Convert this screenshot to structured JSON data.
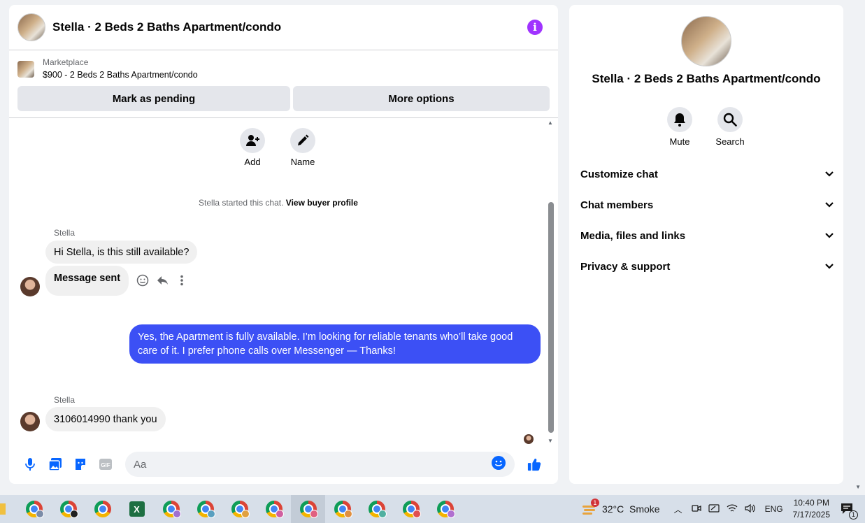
{
  "chat": {
    "title": "Stella · 2 Beds 2 Baths Apartment/condo",
    "marketplace_label": "Marketplace",
    "listing": "$900 - 2 Beds 2 Baths Apartment/condo",
    "mark_pending": "Mark as pending",
    "more_options": "More options",
    "quick_actions": [
      {
        "label": "Add",
        "icon": "add-person-icon"
      },
      {
        "label": "Name",
        "icon": "pencil-icon"
      }
    ],
    "started_text": "Stella started this chat.",
    "view_profile": "View buyer profile",
    "messages": [
      {
        "sender": "Stella",
        "text": "Hi Stella, is this still available?",
        "direction": "in"
      },
      {
        "text": "Message sent",
        "direction": "in"
      },
      {
        "text": "Yes, the Apartment is fully available. I’m looking for reliable tenants who’ll take good care of it. I prefer phone calls over Messenger —  Thanks!",
        "direction": "out"
      },
      {
        "sender": "Stella",
        "text": "3106014990 thank you",
        "direction": "in"
      }
    ],
    "composer_placeholder": "Aa",
    "accent": "#0866ff",
    "outgoing_bubble": "#3c50f5"
  },
  "side": {
    "title": "Stella · 2 Beds 2 Baths Apartment/condo",
    "actions": [
      {
        "label": "Mute",
        "icon": "bell-icon"
      },
      {
        "label": "Search",
        "icon": "search-icon"
      }
    ],
    "sections": [
      "Customize chat",
      "Chat members",
      "Media, files and links",
      "Privacy & support"
    ]
  },
  "taskbar": {
    "weather": "32°C  Smoke",
    "weather_badge": "1",
    "lang": "ENG",
    "time": "10:40 PM",
    "date": "7/17/2025",
    "notifications": "1"
  }
}
